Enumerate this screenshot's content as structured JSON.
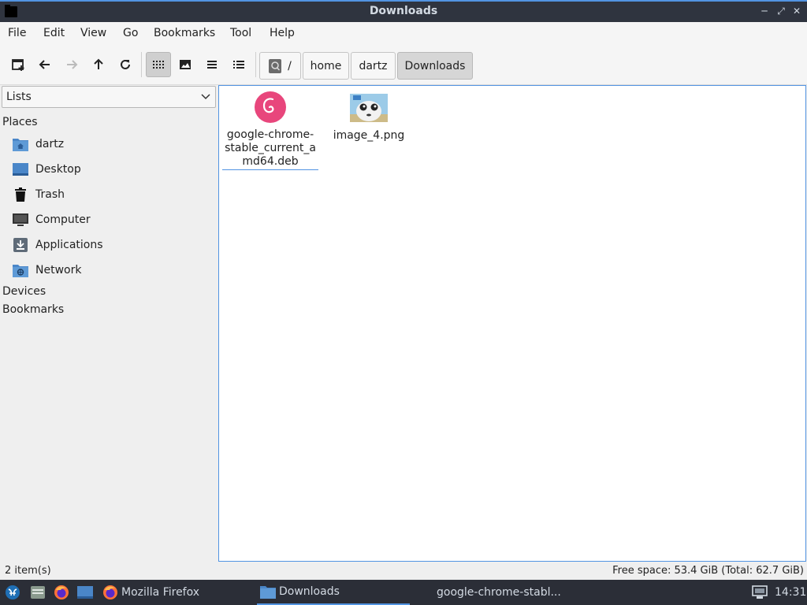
{
  "window": {
    "title": "Downloads"
  },
  "menu": [
    "File",
    "Edit",
    "View",
    "Go",
    "Bookmarks",
    "Tool",
    "Help"
  ],
  "breadcrumb": {
    "root": "/",
    "parts": [
      "home",
      "dartz",
      "Downloads"
    ]
  },
  "sidebar": {
    "combo_value": "Lists",
    "places_header": "Places",
    "places": [
      {
        "label": "dartz",
        "icon": "home-folder-icon"
      },
      {
        "label": "Desktop",
        "icon": "desktop-icon"
      },
      {
        "label": "Trash",
        "icon": "trash-icon"
      },
      {
        "label": "Computer",
        "icon": "computer-icon"
      },
      {
        "label": "Applications",
        "icon": "applications-icon"
      },
      {
        "label": "Network",
        "icon": "network-folder-icon"
      }
    ],
    "devices_header": "Devices",
    "bookmarks_header": "Bookmarks"
  },
  "files": [
    {
      "name": "google-chrome-stable_current_amd64.deb",
      "line1": "google-chrome-",
      "line2": "stable_current_a",
      "line3": "md64.deb",
      "icon": "debian-package-icon"
    },
    {
      "name": "image_4.png",
      "icon": "image-thumbnail"
    }
  ],
  "status": {
    "items": "2 item(s)",
    "free": "Free space: 53.4 GiB (Total: 62.7 GiB)"
  },
  "taskbar": {
    "firefox_label": "Mozilla Firefox",
    "files_label": "Downloads",
    "chrome_label": "google-chrome-stabl...",
    "clock": "14:31"
  },
  "colors": {
    "accent": "#5294e2",
    "titlebar": "#2f343f",
    "taskbar": "#2b2e37",
    "debian": "#e8467c"
  }
}
